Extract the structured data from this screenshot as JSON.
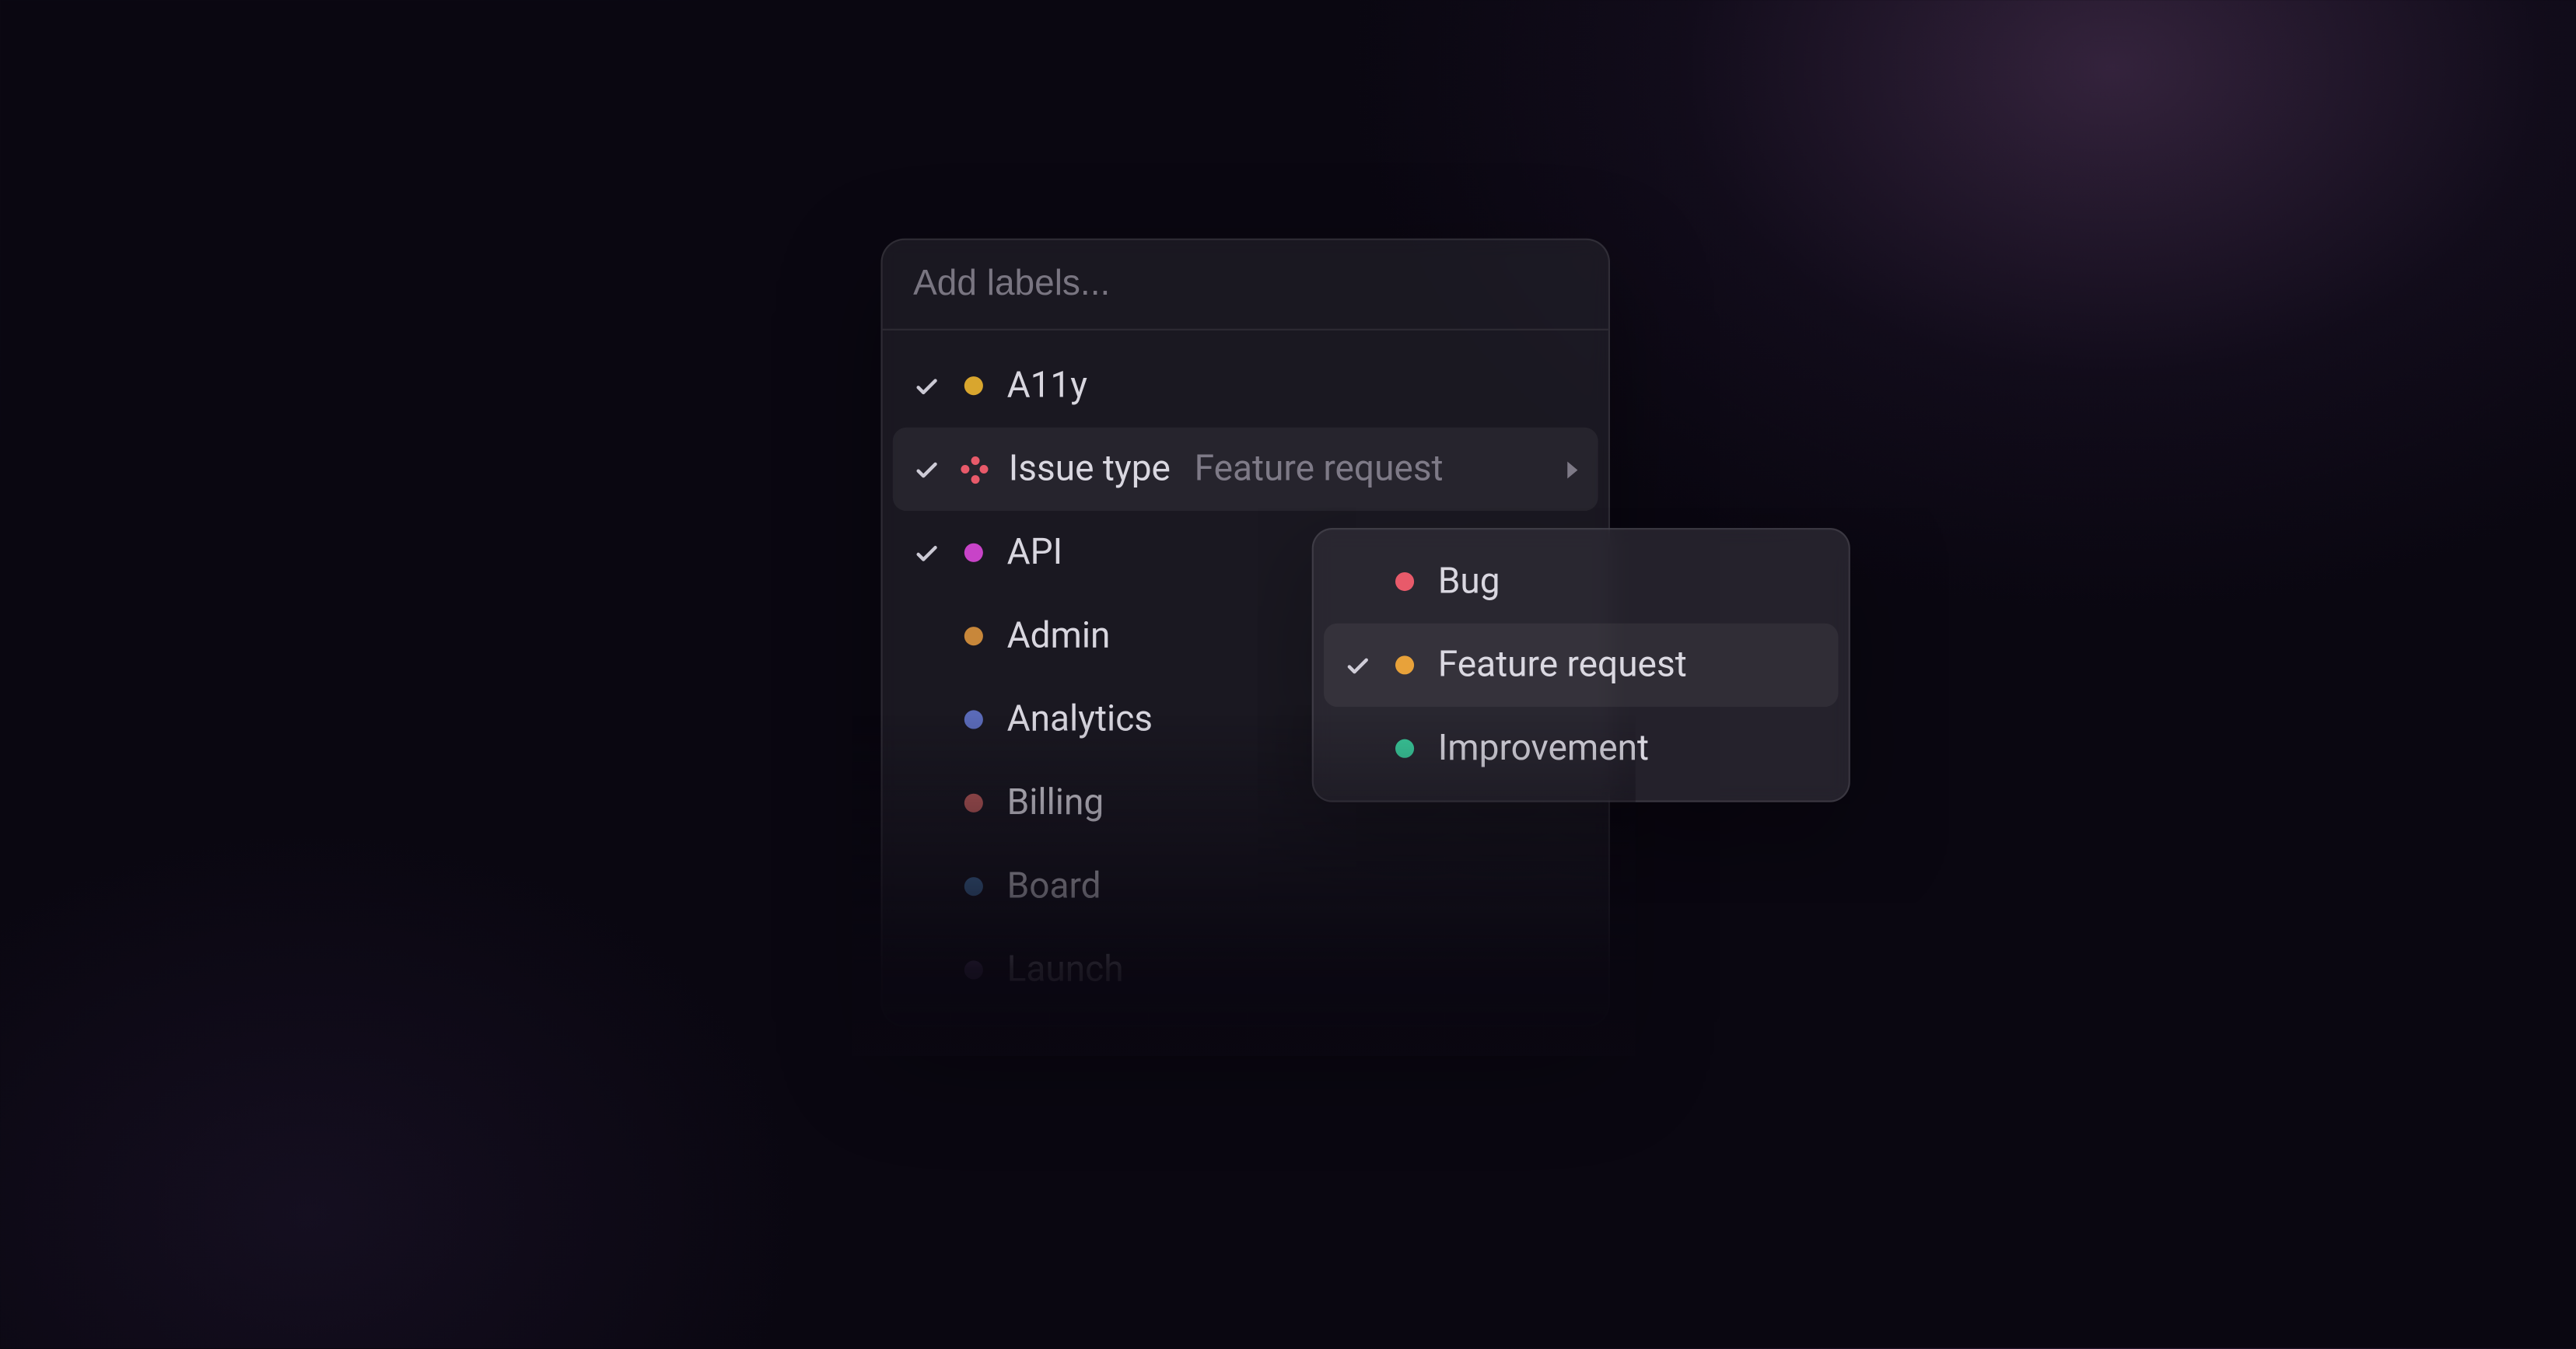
{
  "search": {
    "placeholder": "Add labels...",
    "value": ""
  },
  "labels": [
    {
      "name": "A11y",
      "checked": true,
      "dot": "#d9a62e",
      "type": "label"
    },
    {
      "name": "Issue type",
      "checked": true,
      "type": "group",
      "selected": "Feature request"
    },
    {
      "name": "API",
      "checked": true,
      "dot": "#c843c8",
      "type": "label"
    },
    {
      "name": "Admin",
      "checked": false,
      "dot": "#c8873a",
      "type": "label"
    },
    {
      "name": "Analytics",
      "checked": false,
      "dot": "#5a6ab8",
      "type": "label"
    },
    {
      "name": "Billing",
      "checked": false,
      "dot": "#b85a5a",
      "type": "label"
    },
    {
      "name": "Board",
      "checked": false,
      "dot": "#4a7ab0",
      "type": "label"
    },
    {
      "name": "Launch",
      "checked": false,
      "dot": "#8a6ab0",
      "type": "label"
    }
  ],
  "highlighted_label_index": 1,
  "submenu": {
    "items": [
      {
        "name": "Bug",
        "checked": false,
        "dot": "#e85a6a"
      },
      {
        "name": "Feature request",
        "checked": true,
        "dot": "#e8a23a"
      },
      {
        "name": "Improvement",
        "checked": false,
        "dot": "#3ac99a"
      }
    ],
    "highlighted_index": 1
  },
  "colors": {
    "background": "#0a0711",
    "panel": "rgba(40,38,48,0.55)",
    "submenu_panel": "rgba(48,46,56,0.70)",
    "text": "rgba(233,231,240,0.92)",
    "muted": "rgba(200,195,210,0.55)"
  }
}
